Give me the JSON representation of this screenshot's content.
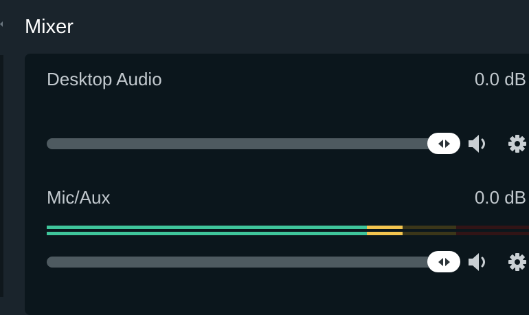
{
  "dock": {
    "title": "Mixer"
  },
  "channels": [
    {
      "name": "Desktop Audio",
      "volume_db": "0.0 dB",
      "volume_level": 1.0,
      "meter_visible": false,
      "mute_icon": "speaker-icon",
      "settings_icon": "gear-icon"
    },
    {
      "name": "Mic/Aux",
      "volume_db": "0.0 dB",
      "volume_level": 1.0,
      "meter_visible": true,
      "meter_level": 0.74,
      "mute_icon": "speaker-icon",
      "settings_icon": "gear-icon"
    }
  ],
  "colors": {
    "meter_green": "#3fc59b",
    "meter_yellow": "#f3c54f",
    "panel_bg": "#0b161c",
    "dock_bg": "#1a242c"
  }
}
